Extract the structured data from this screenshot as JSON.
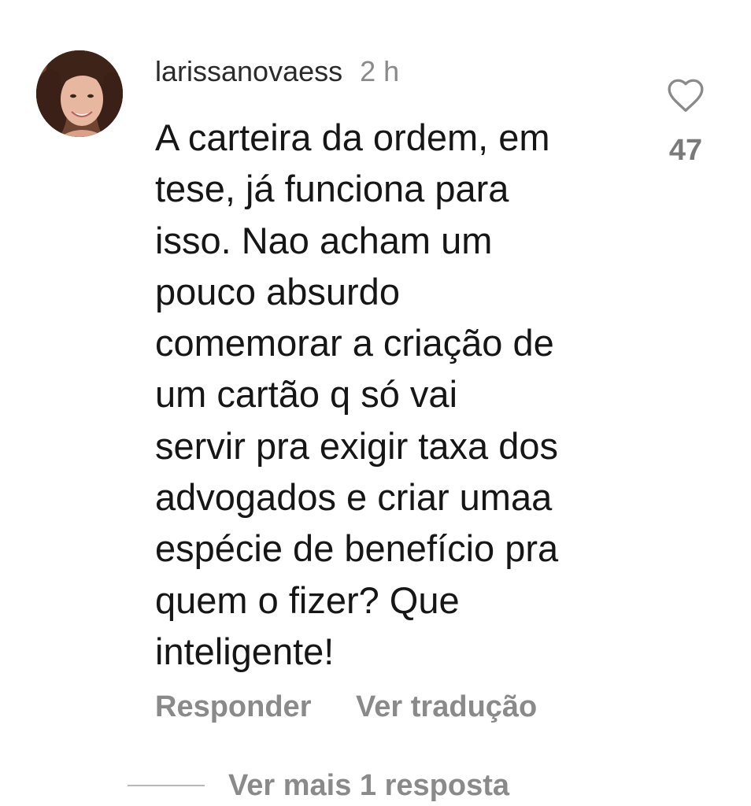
{
  "comment": {
    "author": {
      "username": "larissanovaess",
      "avatar_icon": "user-avatar-photo"
    },
    "timestamp": "2 h",
    "lines": [
      "A carteira da ordem, em",
      "tese,  já funciona para",
      "isso. Nao acham um",
      "pouco absurdo",
      "comemorar a criação de",
      "um cartão q só vai",
      "servir pra exigir taxa dos",
      "advogados e criar umaa",
      "espécie de benefício pra",
      "quem o fizer? Que",
      "inteligente!"
    ],
    "likes": {
      "icon": "heart-icon",
      "count": "47"
    },
    "actions": {
      "reply_label": "Responder",
      "translate_label": "Ver tradução"
    },
    "more_replies_label": "Ver mais 1 resposta"
  },
  "colors": {
    "text_primary": "#161616",
    "text_secondary": "#8a8a8a",
    "divider": "#b8b8b8",
    "background": "#ffffff"
  }
}
